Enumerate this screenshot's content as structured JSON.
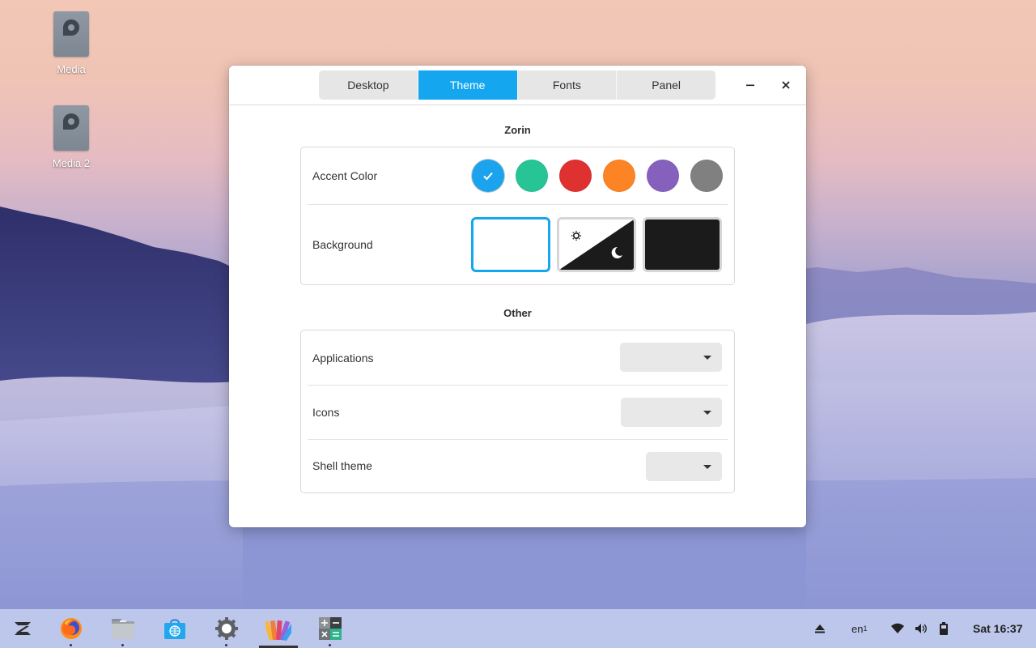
{
  "desktop": {
    "icons": [
      {
        "label": "Media"
      },
      {
        "label": "Media 2"
      }
    ]
  },
  "window": {
    "tabs": [
      {
        "label": "Desktop",
        "active": false
      },
      {
        "label": "Theme",
        "active": true
      },
      {
        "label": "Fonts",
        "active": false
      },
      {
        "label": "Panel",
        "active": false
      }
    ],
    "controls": {
      "minimize": "minimize-icon",
      "close": "close-icon"
    }
  },
  "zorin": {
    "title": "Zorin",
    "accent": {
      "label": "Accent Color",
      "colors": [
        "#1ba3ee",
        "#27c495",
        "#e03131",
        "#fd8424",
        "#8561bd",
        "#808080"
      ],
      "selected_index": 0
    },
    "background": {
      "label": "Background",
      "options": [
        "light",
        "auto",
        "dark"
      ],
      "selected": "light"
    }
  },
  "other": {
    "title": "Other",
    "rows": [
      {
        "label": "Applications",
        "value": ""
      },
      {
        "label": "Icons",
        "value": ""
      },
      {
        "label": "Shell theme",
        "value": ""
      }
    ]
  },
  "taskbar": {
    "apps": [
      "zorin-menu-icon",
      "firefox-icon",
      "files-icon",
      "software-store-icon",
      "settings-icon",
      "appearance-icon",
      "calculator-icon"
    ],
    "active_app": "appearance-icon",
    "tray": {
      "keyboard_layout": "en",
      "keyboard_layout_sub": "1",
      "clock": "Sat 16:37"
    },
    "tray_icons": [
      "eject-icon",
      "wifi-icon",
      "volume-icon",
      "battery-icon"
    ]
  }
}
